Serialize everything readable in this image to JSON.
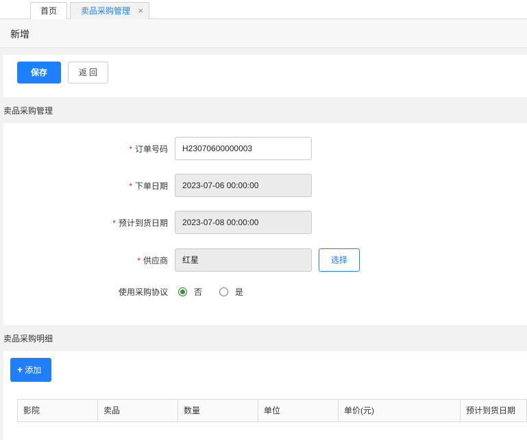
{
  "tabs": {
    "home": "首页",
    "active": "卖品采购管理",
    "close_glyph": "×"
  },
  "page": {
    "title": "新增"
  },
  "toolbar": {
    "save": "保存",
    "back": "返 回"
  },
  "sections": {
    "main": "卖品采购管理",
    "detail": "卖品采购明细"
  },
  "form": {
    "order_no": {
      "label": "订单号码",
      "value": "H23070600000003"
    },
    "order_date": {
      "label": "下单日期",
      "value": "2023-07-06 00:00:00"
    },
    "arrival_date": {
      "label": "预计到货日期",
      "value": "2023-07-08 00:00:00"
    },
    "supplier": {
      "label": "供应商",
      "value": "红星",
      "select": "选择"
    },
    "agreement": {
      "label": "使用采购协议",
      "options": [
        "否",
        "是"
      ],
      "selected": "否"
    },
    "required_mark": "*"
  },
  "detail": {
    "add": "添加",
    "columns": [
      "影院",
      "卖品",
      "数量",
      "单位",
      "单价(元)",
      "预计到货日期"
    ]
  },
  "colors": {
    "accent": "#1e80ff",
    "required": "#e02020",
    "radio_checked": "#2e9b2e"
  }
}
